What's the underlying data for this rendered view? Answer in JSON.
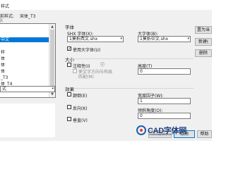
{
  "window": {
    "title": "样式"
  },
  "current_style": {
    "label": "前样式:",
    "value": "宋体_T3"
  },
  "styles_label": "):",
  "styles_list": [
    "",
    "",
    "中文",
    "",
    "样",
    "体",
    "体",
    "体",
    "_T3",
    "体_T4",
    "体 T5"
  ],
  "selected_style_index": 2,
  "list_filter": {
    "value": "式",
    "caret": "▾"
  },
  "font": {
    "section": "字体",
    "shx_label": "SHX 字体(X):",
    "shx_value": "1莫析西文.shx",
    "big_label": "大字体(B):",
    "big_value": "1莫析中文.shx",
    "use_big_font_label": "使用大字体(U)",
    "use_big_font_checked": true
  },
  "size": {
    "section": "大小",
    "annotative_label": "注释性(I)",
    "annotative_checked": false,
    "match_layout_label": "使文字方向与布局",
    "match_layout_label2": "匹配(M)",
    "height_label": "高度(T)",
    "height_value": "0"
  },
  "effects": {
    "section": "效果",
    "upside_down_label": "颠倒(E)",
    "backwards_label": "反向(K)",
    "vertical_label": "垂直(V)",
    "width_factor_label": "宽度因子(W):",
    "width_factor_value": "1",
    "oblique_label": "倾斜角度(O):",
    "oblique_value": "0"
  },
  "buttons": {
    "set_current": "置为当",
    "new": "新建(",
    "delete": "删除",
    "apply": "应用(A)",
    "cancel": "取消",
    "help": "帮助"
  },
  "watermark": {
    "text": "CAD字体网",
    "url": "www.cadzitiw.com"
  }
}
